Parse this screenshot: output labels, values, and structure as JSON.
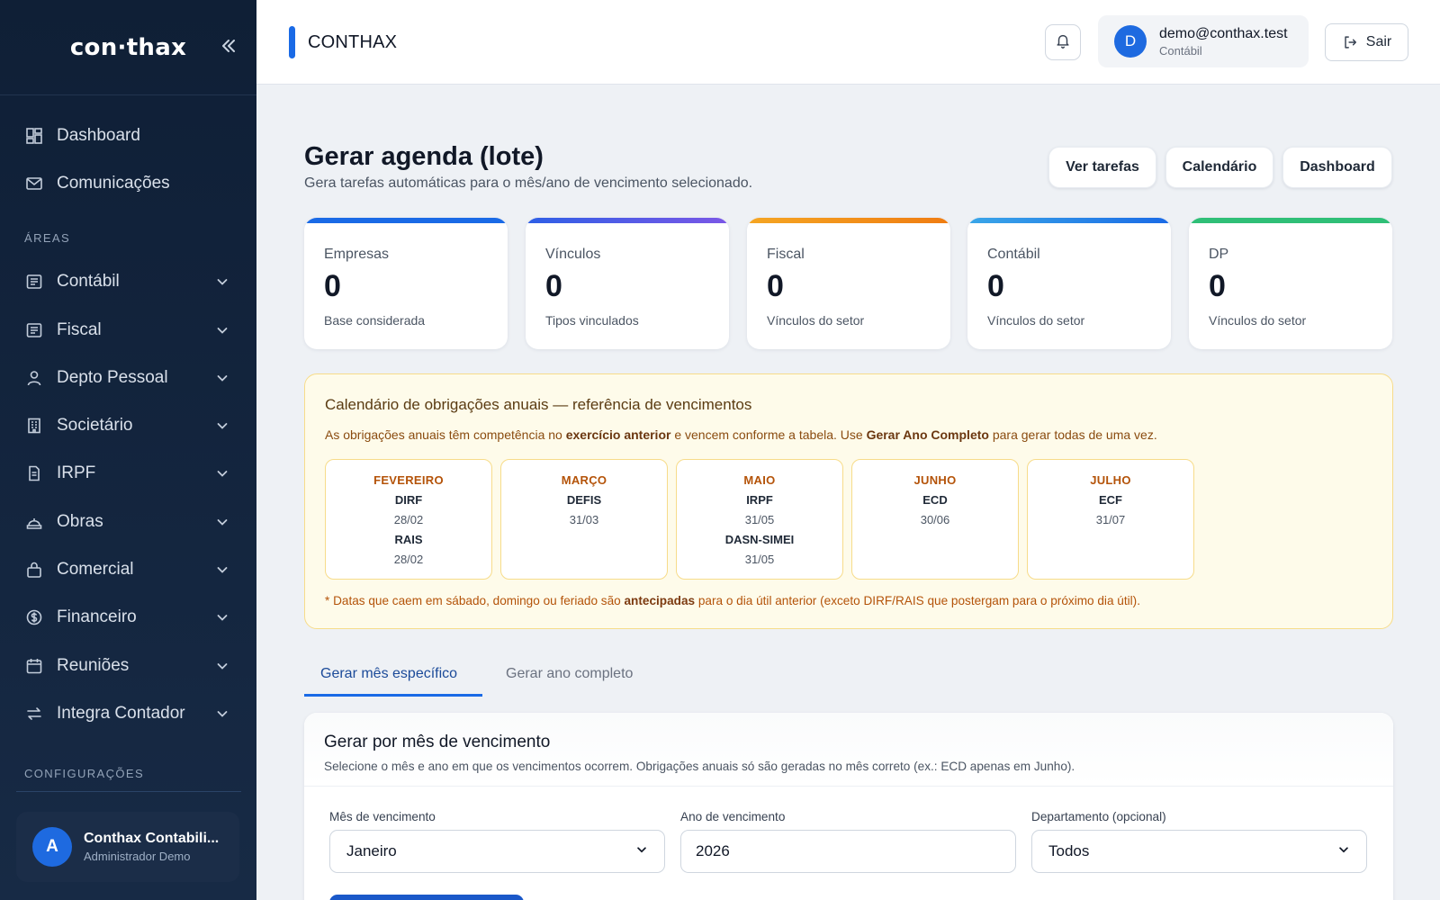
{
  "sidebar": {
    "brand": "con·thax",
    "items_top": [
      {
        "label": "Dashboard",
        "icon": "dashboard-icon"
      },
      {
        "label": "Comunicações",
        "icon": "mail-icon"
      }
    ],
    "section_areas": "ÁREAS",
    "areas": [
      {
        "label": "Contábil",
        "icon": "ledger-icon"
      },
      {
        "label": "Fiscal",
        "icon": "ledger-icon"
      },
      {
        "label": "Depto Pessoal",
        "icon": "person-icon"
      },
      {
        "label": "Societário",
        "icon": "building-icon"
      },
      {
        "label": "IRPF",
        "icon": "document-icon"
      },
      {
        "label": "Obras",
        "icon": "construction-icon"
      },
      {
        "label": "Comercial",
        "icon": "bag-icon"
      },
      {
        "label": "Financeiro",
        "icon": "money-icon"
      },
      {
        "label": "Reuniões",
        "icon": "calendar-icon"
      },
      {
        "label": "Integra Contador",
        "icon": "swap-icon"
      }
    ],
    "section_config": "CONFIGURAÇÕES",
    "user": {
      "initial": "A",
      "name": "Conthax Contabili...",
      "role": "Administrador Demo"
    }
  },
  "header": {
    "title": "CONTHAX",
    "account": {
      "initial": "D",
      "email": "demo@conthax.test",
      "role": "Contábil"
    },
    "logout_label": "Sair"
  },
  "page": {
    "title": "Gerar agenda (lote)",
    "subtitle": "Gera tarefas automáticas para o mês/ano de vencimento selecionado.",
    "buttons": [
      "Ver tarefas",
      "Calendário",
      "Dashboard"
    ]
  },
  "stats": [
    {
      "label": "Empresas",
      "value": "0",
      "sub": "Base considerada",
      "color": "#1a6ae6"
    },
    {
      "label": "Vínculos",
      "value": "0",
      "sub": "Tipos vinculados",
      "color": "#6d5ae8"
    },
    {
      "label": "Fiscal",
      "value": "0",
      "sub": "Vínculos do setor",
      "color": "#f08a18"
    },
    {
      "label": "Contábil",
      "value": "0",
      "sub": "Vínculos do setor",
      "color": "#2f96e8"
    },
    {
      "label": "DP",
      "value": "0",
      "sub": "Vínculos do setor",
      "color": "#2fbf77"
    }
  ],
  "obligations": {
    "title": "Calendário de obrigações anuais — referência de vencimentos",
    "desc_1": "As obrigações anuais têm competência no ",
    "desc_b1": "exercício anterior",
    "desc_2": " e vencem conforme a tabela. Use ",
    "desc_b2": "Gerar Ano Completo",
    "desc_3": " para gerar todas de uma vez.",
    "months": [
      {
        "name": "FEVEREIRO",
        "items": [
          {
            "name": "DIRF",
            "date": "28/02"
          },
          {
            "name": "RAIS",
            "date": "28/02"
          }
        ]
      },
      {
        "name": "MARÇO",
        "items": [
          {
            "name": "DEFIS",
            "date": "31/03"
          }
        ]
      },
      {
        "name": "MAIO",
        "items": [
          {
            "name": "IRPF",
            "date": "31/05"
          },
          {
            "name": "DASN-SIMEI",
            "date": "31/05"
          }
        ]
      },
      {
        "name": "JUNHO",
        "items": [
          {
            "name": "ECD",
            "date": "30/06"
          }
        ]
      },
      {
        "name": "JULHO",
        "items": [
          {
            "name": "ECF",
            "date": "31/07"
          }
        ]
      }
    ],
    "note_1": "* Datas que caem em sábado, domingo ou feriado são ",
    "note_b": "antecipadas",
    "note_2": " para o dia útil anterior (exceto DIRF/RAIS que postergam para o próximo dia útil)."
  },
  "tabs": {
    "active": "Gerar mês específico",
    "inactive": "Gerar ano completo"
  },
  "form": {
    "title": "Gerar por mês de vencimento",
    "subtitle": "Selecione o mês e ano em que os vencimentos ocorrem. Obrigações anuais só são geradas no mês correto (ex.: ECD apenas em Junho).",
    "month_label": "Mês de vencimento",
    "month_value": "Janeiro",
    "year_label": "Ano de vencimento",
    "year_value": "2026",
    "dept_label": "Departamento (opcional)",
    "dept_value": "Todos"
  }
}
